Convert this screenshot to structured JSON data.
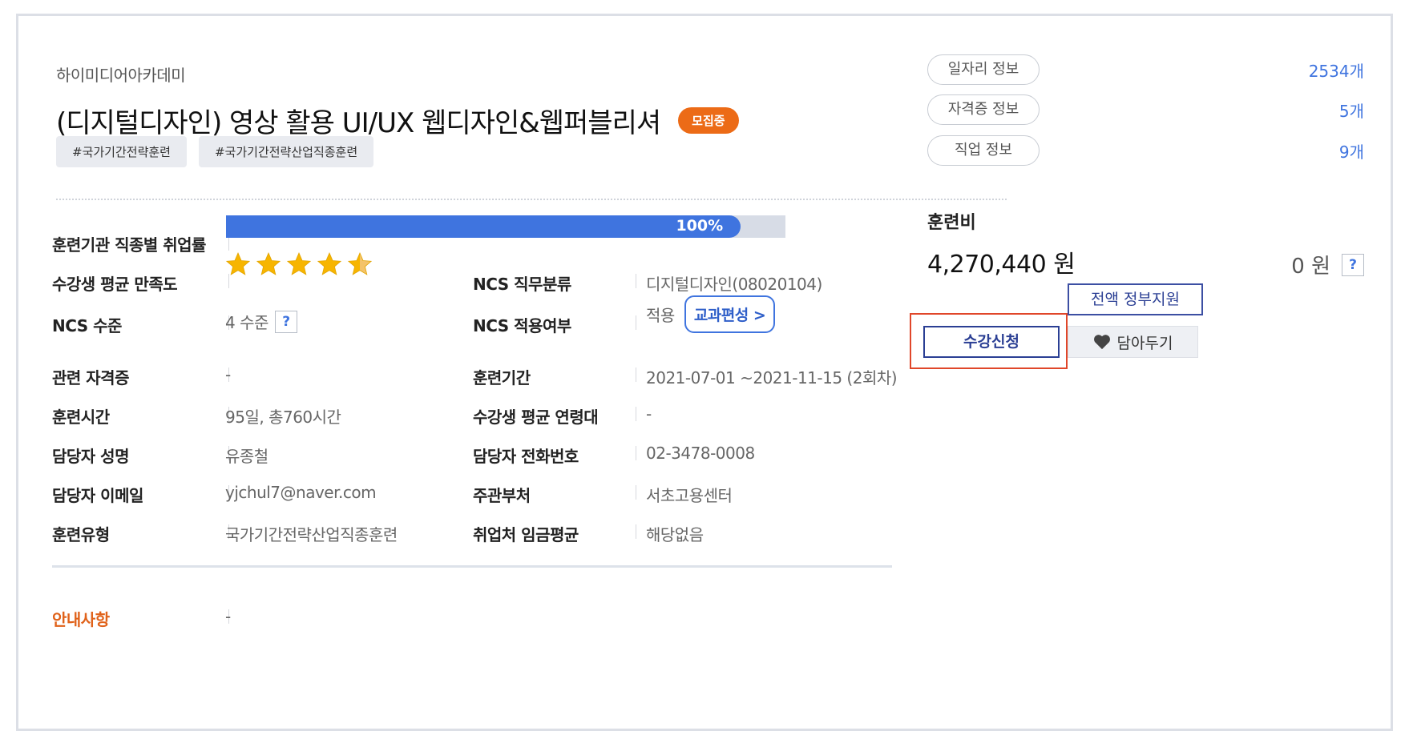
{
  "course": {
    "institution": "하이미디어아카데미",
    "title": "(디지털디자인) 영상 활용 UI/UX 웹디자인&웹퍼블리셔",
    "status_badge": "모집중",
    "tags": [
      "#국가기간전략훈련",
      "#국가기간전략산업직종훈련"
    ]
  },
  "employment_rate": {
    "label": "훈련기관 직종별 취업률",
    "value_text": "100%",
    "value": 1.0
  },
  "details": {
    "satisfaction": {
      "label": "수강생 평균 만족도",
      "stars": 4.5,
      "max_stars": 5
    },
    "ncs_job": {
      "label": "NCS 직무분류",
      "value": "디지털디자인(08020104)"
    },
    "ncs_level": {
      "label": "NCS 수준",
      "value": "4 수준",
      "help": "?"
    },
    "ncs_applied": {
      "label": "NCS 적용여부",
      "value": "적용",
      "button": "교과편성 >"
    },
    "certificate": {
      "label": "관련 자격증",
      "value": "-"
    },
    "period": {
      "label": "훈련기간",
      "value": "2021-07-01 ~2021-11-15 (2회차)"
    },
    "hours": {
      "label": "훈련시간",
      "value": "95일, 총760시간"
    },
    "avg_age": {
      "label": "수강생 평균 연령대",
      "value": "-"
    },
    "manager_name": {
      "label": "담당자 성명",
      "value": "유종철"
    },
    "manager_phone": {
      "label": "담당자 전화번호",
      "value": "02-3478-0008"
    },
    "manager_email": {
      "label": "담당자 이메일",
      "value": "yjchul7@naver.com"
    },
    "department": {
      "label": "주관부처",
      "value": "서초고용센터"
    },
    "training_type": {
      "label": "훈련유형",
      "value": "국가기간전략산업직종훈련"
    },
    "avg_wage": {
      "label": "취업처 임금평균",
      "value": "해당없음"
    }
  },
  "notice": {
    "label": "안내사항",
    "value": "-"
  },
  "sidebar": {
    "info_links": [
      {
        "label": "일자리 정보",
        "count": "2534개"
      },
      {
        "label": "자격증 정보",
        "count": "5개"
      },
      {
        "label": "직업 정보",
        "count": "9개"
      }
    ],
    "fee_title": "훈련비",
    "fee_amount": "4,270,440 원",
    "self_pay": "0 원",
    "help": "?",
    "gov_support": "전액 정부지원",
    "apply": "수강신청",
    "wishlist": "담아두기"
  },
  "colors": {
    "accent": "#3f74df",
    "badge": "#ec6b17",
    "highlight_border": "#e0472a",
    "star": "#f7b500"
  }
}
